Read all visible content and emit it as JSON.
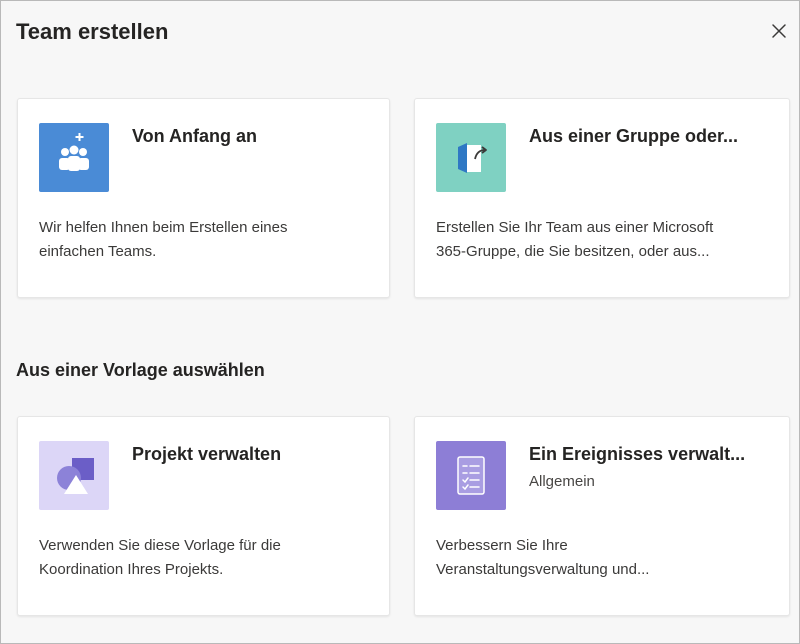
{
  "dialog": {
    "title": "Team erstellen",
    "close_icon": "close-icon"
  },
  "top_cards": [
    {
      "title": "Von Anfang an",
      "description_line1": "Wir helfen Ihnen beim Erstellen eines",
      "description_line2": "einfachen Teams.",
      "icon": "team-add-icon",
      "tile_color": "#4a8bd6"
    },
    {
      "title": "Aus einer Gruppe oder...",
      "description_line1": "Erstellen Sie Ihr Team aus einer Microsoft",
      "description_line2": "365-Gruppe, die Sie besitzen, oder aus...",
      "icon": "group-share-icon",
      "tile_color": "#7fd1c2"
    }
  ],
  "section": {
    "title": "Aus einer Vorlage auswählen"
  },
  "template_cards": [
    {
      "title": "Projekt verwalten",
      "subtitle": "",
      "description_line1": "Verwenden Sie diese Vorlage für die",
      "description_line2": "Koordination Ihres Projekts.",
      "icon": "shapes-icon",
      "tile_color": "#dcd6f7"
    },
    {
      "title": "Ein Ereignisses verwalt...",
      "subtitle": "Allgemein",
      "description_line1": "Verbessern Sie Ihre",
      "description_line2": "Veranstaltungsverwaltung und...",
      "icon": "checklist-icon",
      "tile_color": "#8d7ed6"
    }
  ]
}
